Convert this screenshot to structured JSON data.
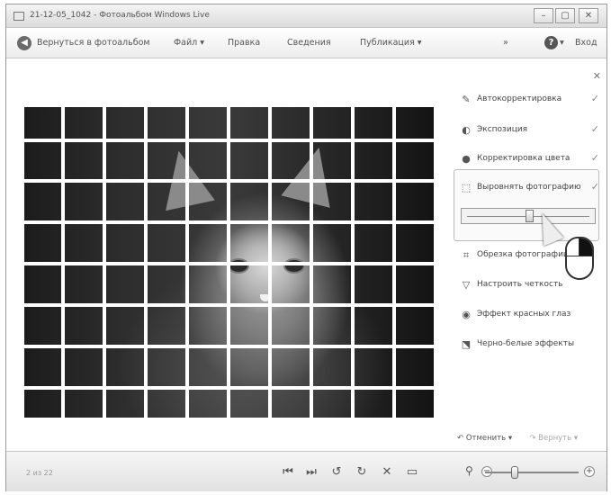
{
  "window": {
    "title": "21-12-05_1042 - Фотоальбом Windows Live",
    "buttons": {
      "minimize": "–",
      "maximize": "▢",
      "close": "✕"
    }
  },
  "menubar": {
    "back_label": "Вернуться в фотоальбом",
    "items": [
      "Файл ▾",
      "Правка",
      "Сведения",
      "Публикация ▾"
    ],
    "scroll_glyph": "»",
    "help_label": "?",
    "help_arrow": "▾",
    "signin_label": "Вход"
  },
  "panel": {
    "close_glyph": "✕",
    "fixes": [
      {
        "label": "Автокорректировка",
        "icon": "magic-wand-icon",
        "icon_glyph": "✎",
        "check": "✓"
      },
      {
        "label": "Экспозиция",
        "icon": "exposure-icon",
        "icon_glyph": "◐",
        "check": "✓"
      },
      {
        "label": "Корректировка цвета",
        "icon": "color-icon",
        "icon_glyph": "●",
        "check": "✓"
      },
      {
        "label": "Выровнять фотографию",
        "icon": "straighten-icon",
        "icon_glyph": "⬚",
        "check": "✓"
      },
      {
        "label": "Обрезка фотографии",
        "icon": "crop-icon",
        "icon_glyph": "⌗",
        "check": ""
      },
      {
        "label": "Настроить четкость",
        "icon": "sharpness-icon",
        "icon_glyph": "▽",
        "check": ""
      },
      {
        "label": "Эффект красных глаз",
        "icon": "red-eye-icon",
        "icon_glyph": "◉",
        "check": ""
      },
      {
        "label": "Черно-белые эффекты",
        "icon": "black-white-icon",
        "icon_glyph": "⬔",
        "check": ""
      }
    ],
    "straighten_slider_value": 0.5,
    "undo_label": "↶ Отменить ▾",
    "redo_label": "↷ Вернуть ▾"
  },
  "statusbar": {
    "text": "2 из 22",
    "controls": [
      {
        "name": "previous-icon",
        "glyph": "⏮"
      },
      {
        "name": "next-icon",
        "glyph": "⏭"
      },
      {
        "name": "rotate-left-icon",
        "glyph": "↺"
      },
      {
        "name": "rotate-right-icon",
        "glyph": "↻"
      },
      {
        "name": "delete-icon",
        "glyph": "✕"
      },
      {
        "name": "slideshow-icon",
        "glyph": "▭"
      }
    ],
    "zoom_icon": "⚲",
    "zoom_minus": "−",
    "zoom_plus": "+",
    "zoom_value": 0.3
  },
  "colors": {
    "window_border": "#9a9a9a",
    "toolbar_bg": "#ececec",
    "photo_dark": "#1c1c1c",
    "grid_lines": "#ffffff"
  }
}
